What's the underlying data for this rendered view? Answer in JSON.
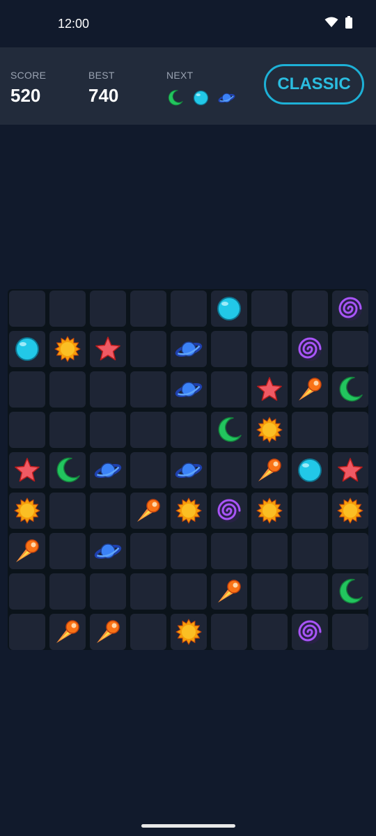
{
  "status_bar": {
    "time": "12:00",
    "icons": [
      "wifi-icon",
      "battery-icon"
    ]
  },
  "header": {
    "score_label": "SCORE",
    "score_value": "520",
    "best_label": "BEST",
    "best_value": "740",
    "next_label": "NEXT",
    "next_pieces": [
      "moon",
      "orb",
      "planet"
    ],
    "mode_button_label": "CLASSIC"
  },
  "board": {
    "rows": 9,
    "cols": 9,
    "cells": [
      [
        "",
        "",
        "",
        "",
        "",
        "orb",
        "",
        "",
        "galaxy"
      ],
      [
        "orb",
        "sun",
        "star",
        "",
        "planet",
        "",
        "",
        "galaxy",
        ""
      ],
      [
        "",
        "",
        "",
        "",
        "planet",
        "",
        "star",
        "comet",
        "moon"
      ],
      [
        "",
        "",
        "",
        "",
        "",
        "moon",
        "sun",
        "",
        ""
      ],
      [
        "star",
        "moon",
        "planet",
        "",
        "planet",
        "",
        "comet",
        "orb",
        "star"
      ],
      [
        "sun",
        "",
        "",
        "comet",
        "sun",
        "galaxy",
        "sun",
        "",
        "sun"
      ],
      [
        "comet",
        "",
        "planet",
        "",
        "",
        "",
        "",
        "",
        ""
      ],
      [
        "",
        "",
        "",
        "",
        "",
        "comet",
        "",
        "",
        "moon"
      ],
      [
        "",
        "comet",
        "comet",
        "",
        "sun",
        "",
        "",
        "galaxy",
        ""
      ]
    ]
  },
  "piece_colors": {
    "orb": "#22c8e8",
    "sun": "#fbbf24",
    "star": "#f05a64",
    "planet": "#3b82f6",
    "galaxy": "#a855f7",
    "comet": "#f97316",
    "moon": "#22c55e"
  }
}
